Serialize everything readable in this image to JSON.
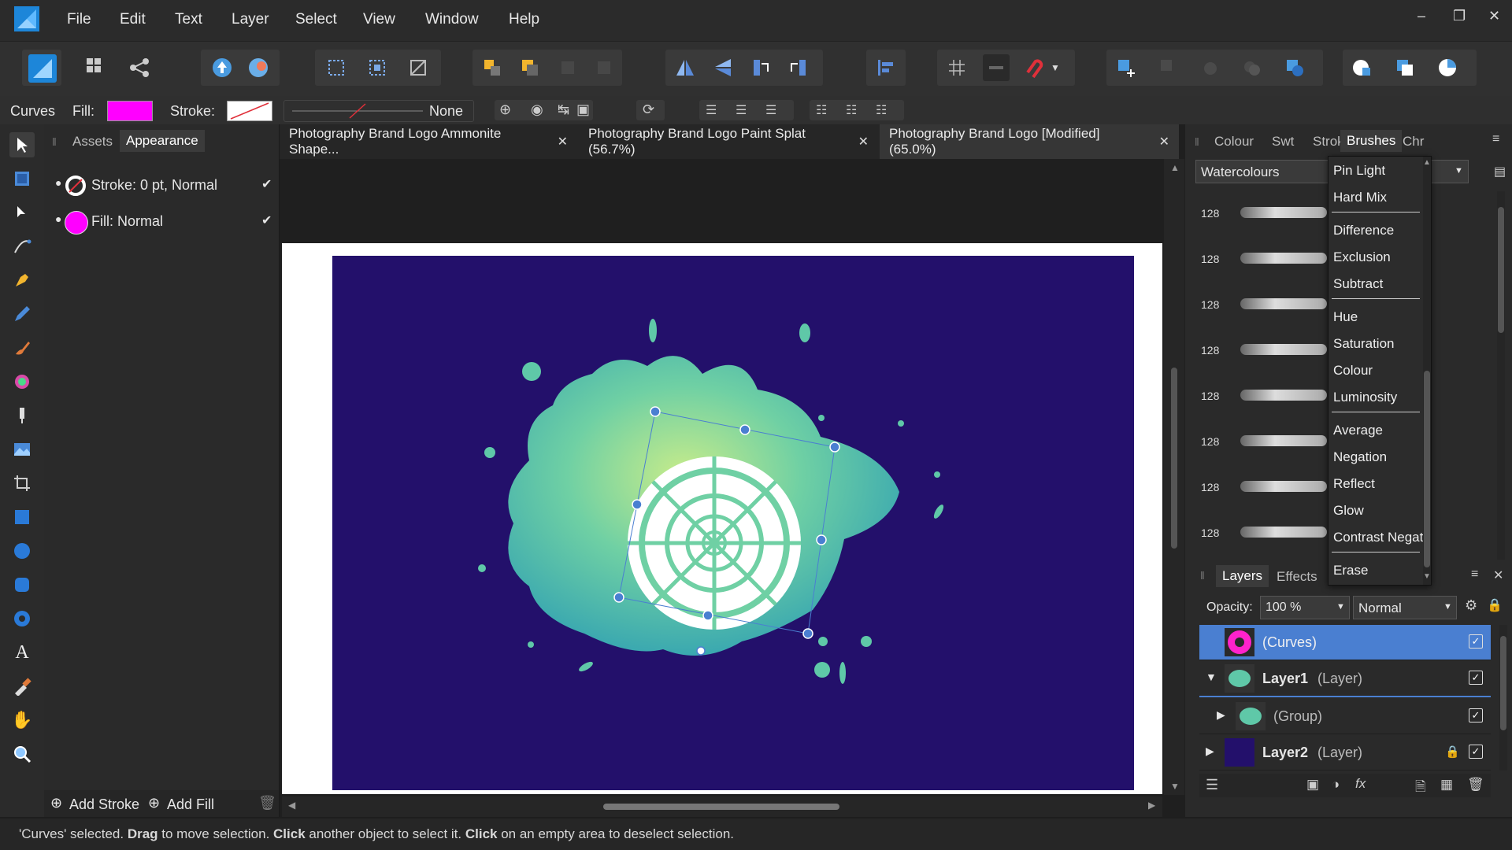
{
  "app": {
    "accent": "#4a7fd1"
  },
  "menu": [
    "File",
    "Edit",
    "Text",
    "Layer",
    "Select",
    "View",
    "Window",
    "Help"
  ],
  "context": {
    "tool": "Curves",
    "fill_label": "Fill:",
    "stroke_label": "Stroke:",
    "line_style": "None",
    "fill_color": "#ff00ff"
  },
  "left_panel": {
    "tabs": [
      "Assets",
      "Appearance"
    ],
    "stroke_row": "Stroke: 0 pt,  Normal",
    "fill_row": "Fill:  Normal",
    "add_stroke": "Add Stroke",
    "add_fill": "Add Fill"
  },
  "doc_tabs": [
    {
      "label": "Photography Brand Logo Ammonite Shape..."
    },
    {
      "label": "Photography Brand Logo Paint Splat (56.7%)"
    },
    {
      "label": "Photography Brand Logo [Modified] (65.0%)"
    }
  ],
  "right_tabs": [
    "Colour",
    "Swt",
    "Stroke",
    "Brushes",
    "Chr"
  ],
  "brushes": {
    "category": "Watercolours",
    "sizes": [
      "128",
      "128",
      "128",
      "128",
      "128",
      "128",
      "128",
      "128"
    ]
  },
  "blend_menu": {
    "groups": [
      [
        "Pin Light",
        "Hard Mix"
      ],
      [
        "Difference",
        "Exclusion",
        "Subtract"
      ],
      [
        "Hue",
        "Saturation",
        "Colour",
        "Luminosity"
      ],
      [
        "Average",
        "Negation",
        "Reflect",
        "Glow",
        "Contrast Negate"
      ],
      [
        "Erase"
      ]
    ]
  },
  "layers_panel": {
    "tabs": [
      "Layers",
      "Effects"
    ],
    "opacity_label": "Opacity:",
    "opacity_value": "100 %",
    "blend_mode": "Normal",
    "rows": [
      {
        "name": "(Curves)",
        "bold": "",
        "type": ""
      },
      {
        "name": "Layer1",
        "bold": "Layer1",
        "type": "(Layer)"
      },
      {
        "name": "(Group)",
        "bold": "",
        "type": ""
      },
      {
        "name": "Layer2",
        "bold": "Layer2",
        "type": "(Layer)"
      }
    ]
  },
  "status": {
    "q1": "'Curves' selected. ",
    "b1": "Drag",
    "t1": " to move selection. ",
    "b2": "Click",
    "t2": " another object to select it. ",
    "b3": "Click",
    "t3": " on an empty area to deselect selection."
  },
  "canvas": {
    "background": "#23106b",
    "splat": "#5fc8a8"
  }
}
